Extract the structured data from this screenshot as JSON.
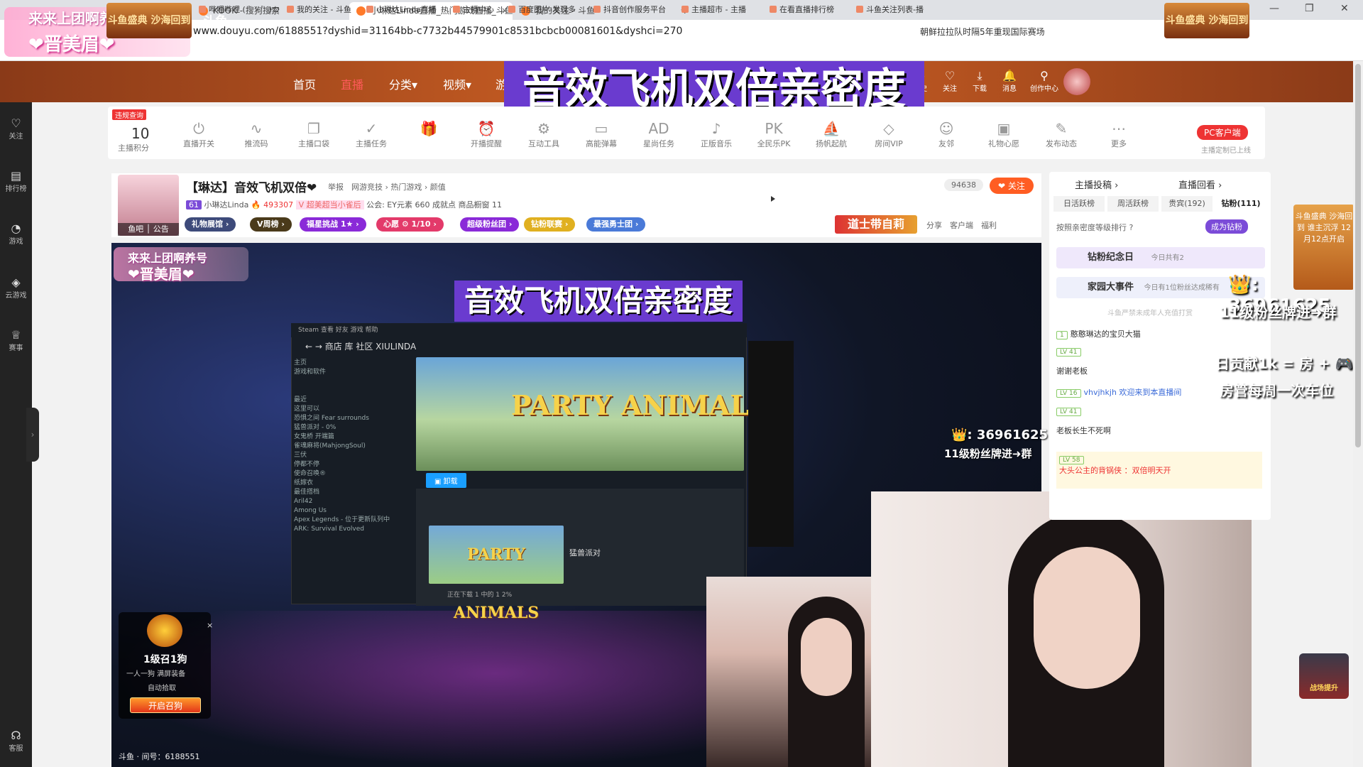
{
  "browser": {
    "tabs": [
      {
        "label": "KOOK - 搜狗搜索"
      },
      {
        "label": "小琳达Linda直播_热门游戏直播_斗鱼"
      },
      {
        "label": "我的关注 - 斗鱼"
      }
    ],
    "new_tab": "+",
    "url": "www.douyu.com/6188551?dyshid=31164bb-c7732b44579901c8531bcbcb00081601&dyshci=270",
    "search_hint": "朝鲜拉拉队时隔5年重现国际赛场",
    "bookmarks": [
      "哔哩哔哩 ( ゜- ゜)つ",
      "我的关注 - 斗鱼",
      "小琳达Linda直播",
      "主播中心",
      "百度图片-发现多",
      "抖音创作服务平台",
      "主播超市 - 主播",
      "在看直播排行榜",
      "斗鱼关注列表-播"
    ]
  },
  "corner_overlay": {
    "line1": "来来上团啊养号",
    "line2": "❤晋美眉❤"
  },
  "site_header": {
    "logo": "斗鱼",
    "nav": [
      {
        "label": "首页"
      },
      {
        "label": "直播"
      },
      {
        "label": "分类▾"
      },
      {
        "label": "视频▾"
      },
      {
        "label": "游"
      }
    ],
    "banner_left": "斗鱼盛典 沙海回到",
    "banner_right": "斗鱼盛典 沙海回到",
    "icons": [
      {
        "label": "历史",
        "icon": "history-icon"
      },
      {
        "label": "关注",
        "icon": "heart-icon"
      },
      {
        "label": "下载",
        "icon": "download-icon"
      },
      {
        "label": "消息",
        "icon": "bell-icon"
      },
      {
        "label": "创作中心",
        "icon": "bulb-icon"
      }
    ],
    "big_title": "音效飞机双倍亲密度"
  },
  "sidebar": {
    "items": [
      {
        "label": "关注",
        "icon": "♡"
      },
      {
        "label": "排行榜",
        "icon": "▤"
      },
      {
        "label": "游戏",
        "icon": "◔"
      },
      {
        "label": "云游戏",
        "icon": "◈"
      },
      {
        "label": "赛事",
        "icon": "♕"
      },
      {
        "label": "客服",
        "icon": "☊"
      }
    ],
    "arrow": "›"
  },
  "toolbar": {
    "badge": "违规查询",
    "score": "10",
    "score_label": "主播积分",
    "tools": [
      {
        "label": "直播开关",
        "icon": "⏻"
      },
      {
        "label": "推流码",
        "icon": "∿"
      },
      {
        "label": "主播口袋",
        "icon": "❐"
      },
      {
        "label": "主播任务",
        "icon": "✓"
      },
      {
        "label": "",
        "icon": "🎁"
      },
      {
        "label": "开播提醒",
        "icon": "⏰"
      },
      {
        "label": "互动工具",
        "icon": "⚙"
      },
      {
        "label": "高能弹幕",
        "icon": "▭"
      },
      {
        "label": "星尚任务",
        "icon": "AD"
      },
      {
        "label": "正版音乐",
        "icon": "♪"
      },
      {
        "label": "全民乐PK",
        "icon": "PK"
      },
      {
        "label": "扬帆起航",
        "icon": "⛵"
      },
      {
        "label": "房间VIP",
        "icon": "◇"
      },
      {
        "label": "友邻",
        "icon": "☺"
      },
      {
        "label": "礼物心愿",
        "icon": "▣"
      },
      {
        "label": "发布动态",
        "icon": "✎"
      },
      {
        "label": "更多",
        "icon": "⋯"
      }
    ],
    "pc_client": "PC客户端",
    "pc_sub": "主播定制已上线"
  },
  "room": {
    "title": "【琳达】音效飞机双倍❤",
    "categories": "举报　网游竞技 › 热门游戏 › 颜值",
    "level": "61",
    "name": "小琳达Linda",
    "heat": "🔥 493307",
    "tag": "V 超美超当小雀后",
    "guild": "公会: EY元素",
    "achieve": "660 成就点",
    "products": "商品橱窗 11",
    "av_footer": "鱼吧 │ 公告",
    "fans": "94638",
    "follow": "❤ 关注",
    "ad_gift": "道士带自莉",
    "tools": "分享　客户端　福利",
    "pills": [
      "礼物展馆 ›",
      "V周榜 ›",
      "福星挑战 1★ ›",
      "心愿 ⚙ 1/10 ›",
      "超级粉丝团 ›",
      "钻粉联赛 ›",
      "最强勇士团 ›"
    ]
  },
  "video": {
    "overlay_tl1": "来来上团啊养号",
    "overlay_tl2": "❤晋美眉❤",
    "title": "音效飞机双倍亲密度",
    "steam": {
      "top": "Steam 查看 好友 游戏 帮助",
      "nav": "←  →   商店   库   社区   XIULINDA",
      "side": [
        "主页",
        "游戏和软件",
        "",
        "",
        "最近",
        "这里可以",
        "恐惧之间 Fear surrounds",
        "猛兽派对 - 0%",
        "女鬼桥 开端篇",
        "雀魂麻将(MahjongSoul)",
        "三伏",
        "停都不停",
        "使命召唤®",
        "纸嫁衣",
        "最佳搭档",
        "Aril42",
        "Among Us",
        "Apex Legends - 位于更新队列中",
        "ARK: Survival Evolved"
      ],
      "hero": "PARTY ANIMALS",
      "play": "▣ 卸载",
      "thumb": "PARTY ANIMALS",
      "name": "猛兽派对",
      "download": "正在下载 1 中的 1                    2%"
    },
    "right_num": "👑: 36961625",
    "right_2": "11级粉丝牌进➜群",
    "loot": {
      "title": "1级召1狗",
      "sub": "一人一狗 满屏装备",
      "auto": "自动拾取",
      "btn": "开启召狗",
      "close": "×"
    },
    "taskbar": "斗鱼 · 间号：6188551"
  },
  "right_panel": {
    "tab1": "主播投稿 ›",
    "tab2": "直播回看 ›",
    "subtabs": [
      "日活跃榜",
      "周活跃榜",
      "贵宾(192)",
      "钻粉(111)"
    ],
    "rank_hint": "按照亲密度等级排行 ?",
    "become_fan": "成为钻粉",
    "events": [
      {
        "label": "钻粉纪念日",
        "note": "今日共有2"
      },
      {
        "label": "家园大事件",
        "note": "今日有1位粉丝达成稀有"
      }
    ],
    "note": "斗鱼严禁未成年人充值打赏",
    "messages": [
      {
        "lv": "1",
        "text": "憨憨琳达的宝贝大猫"
      },
      {
        "lv": "LV 41",
        "text": "谢谢老板"
      },
      {
        "lv": "LV 16",
        "text": "vhvjhkjh 欢迎来到本直播间"
      },
      {
        "lv": "LV 41",
        "text": "老板长生不死啊"
      },
      {
        "lv": "LV 58",
        "text": "大头公主的背锅侠 ：双倍明天开"
      }
    ],
    "ov1": "👑: 36961625",
    "ov2": "11级粉丝牌进➜群",
    "ov3": "日贡献1k = 房 + 🎮",
    "ov4": "房管每周一次车位",
    "ad": "斗鱼盛典 沙海回到 谁主沉浮 12月12点开启",
    "ad2": "战场提升"
  }
}
